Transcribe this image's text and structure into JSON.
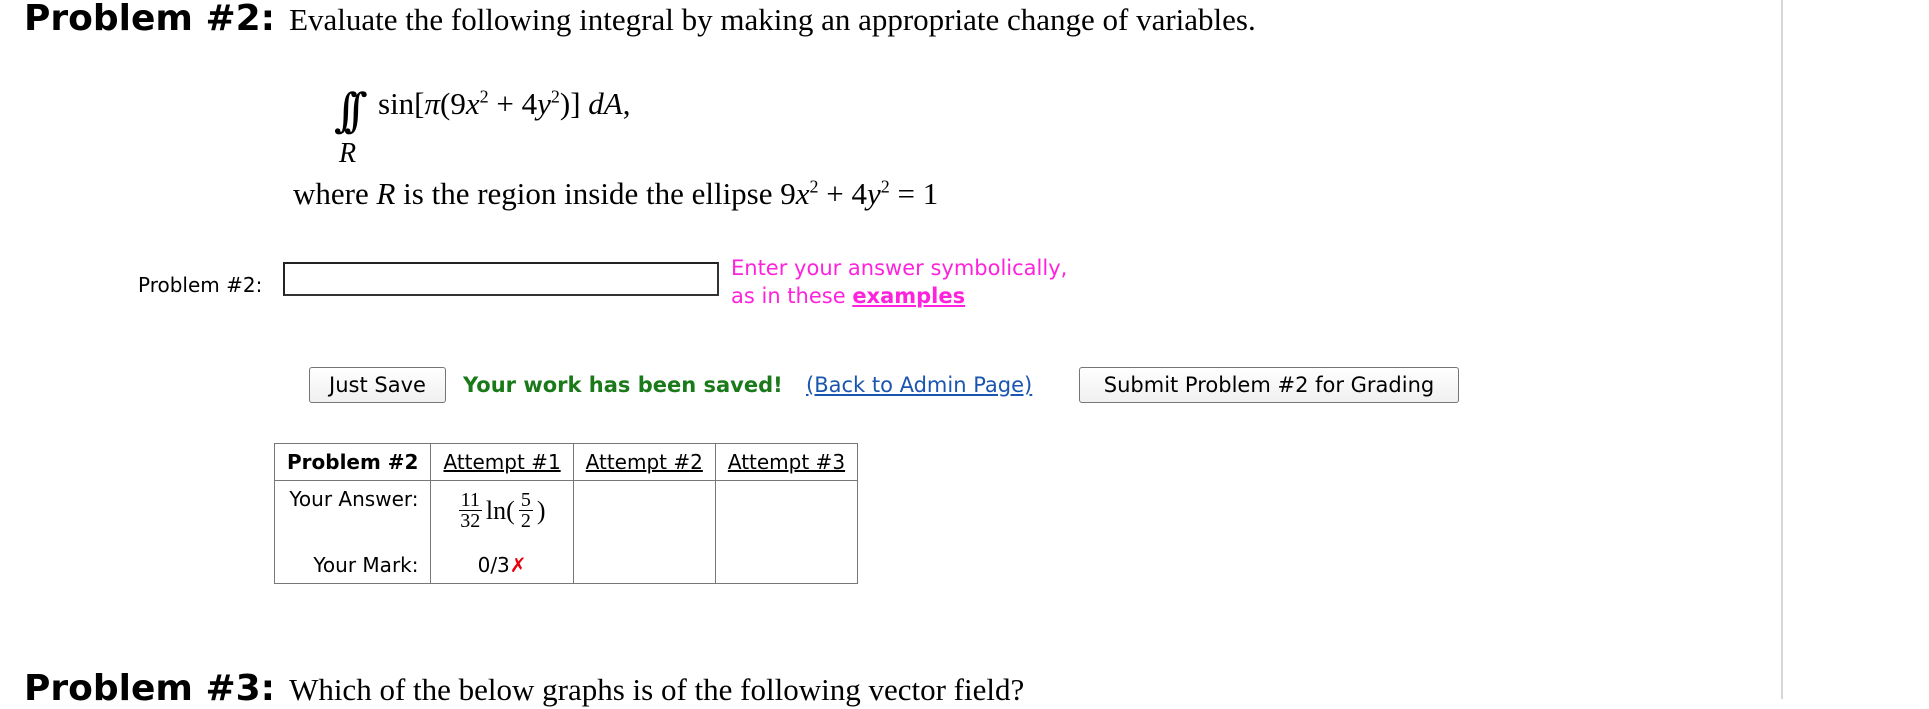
{
  "problem2": {
    "label": "Problem #2:",
    "statement": "Evaluate the following integral by making an appropriate change of variables.",
    "integral": {
      "symbol": "∫∫",
      "region": "R",
      "func": "sin[",
      "pi": "π",
      "open": "(9",
      "x": "x",
      "exp2a": "2",
      "plus": " + 4",
      "y": "y",
      "exp2b": "2",
      "close": ")]",
      "dA": "dA",
      "comma": ","
    },
    "where": {
      "prefix": "where ",
      "R": "R",
      "middle": " is the region inside the ellipse 9",
      "x": "x",
      "exp2a": "2",
      "plus": " + 4",
      "y": "y",
      "exp2b": "2",
      "equals": " = 1"
    },
    "answer_label": "Problem #2:",
    "answer_value": "",
    "hint_line1": "Enter your answer symbolically,",
    "hint_line2": "as in these ",
    "hint_link": "examples"
  },
  "actions": {
    "just_save": "Just Save",
    "saved_msg": "Your work has been saved!",
    "admin_link": "(Back to Admin Page)",
    "submit": "Submit Problem #2 for Grading"
  },
  "attempts_table": {
    "header": "Problem #2",
    "attempt1": "Attempt #1",
    "attempt2": "Attempt #2",
    "attempt3": "Attempt #3",
    "your_answer_label": "Your Answer:",
    "your_mark_label": "Your Mark:",
    "answer1": {
      "frac1_num": "11",
      "frac1_den": "32",
      "ln": "ln(",
      "frac2_num": "5",
      "frac2_den": "2",
      "close": ")"
    },
    "mark1": "0/3",
    "mark1_icon": "✗"
  },
  "problem3": {
    "label": "Problem #3:",
    "statement": "Which of the below graphs is of the following vector field?"
  }
}
